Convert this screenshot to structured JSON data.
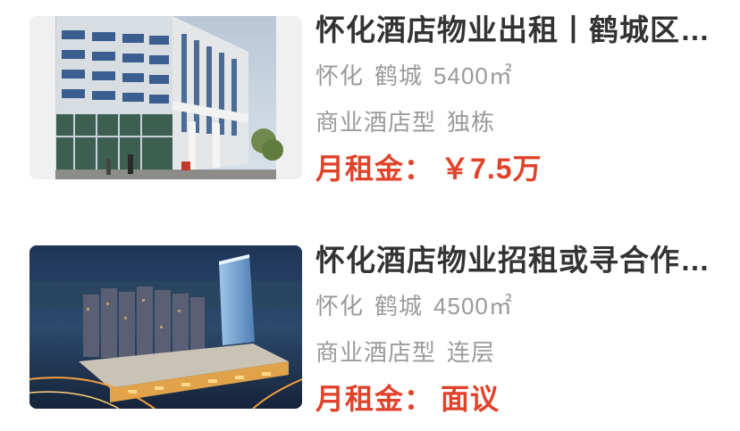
{
  "listings": [
    {
      "title": "怀化酒店物业出租丨鹤城区…",
      "city": "怀化",
      "district": "鹤城",
      "area": "5400㎡",
      "category": "商业酒店型",
      "building": "独栋",
      "price_label": "月租金：",
      "price_value": "￥7.5万",
      "image_icon": "office-building-photo"
    },
    {
      "title": "怀化酒店物业招租或寻合作…",
      "city": "怀化",
      "district": "鹤城",
      "area": "4500㎡",
      "category": "商业酒店型",
      "building": "连层",
      "price_label": "月租金：",
      "price_value": "面议",
      "image_icon": "night-city-complex-rendering"
    }
  ],
  "colors": {
    "title": "#333333",
    "meta": "#9a9a9a",
    "price": "#e0432b"
  }
}
